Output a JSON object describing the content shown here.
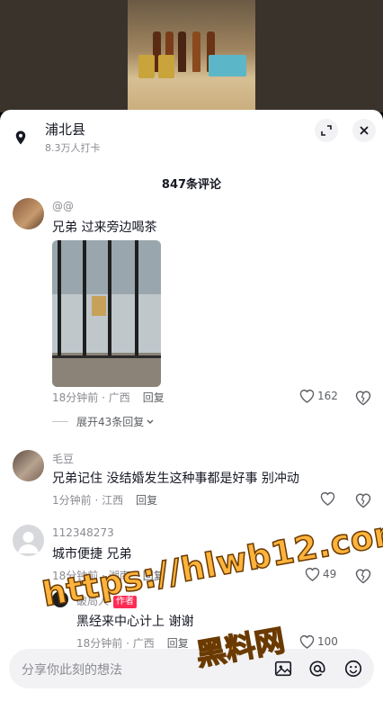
{
  "location": {
    "title": "浦北县",
    "subtitle": "8.3万人打卡"
  },
  "comment_count": "847条评论",
  "comments": [
    {
      "user": "@@",
      "text": "兄弟 过来旁边喝茶",
      "time": "18分钟前 · 广西",
      "reply": "回复",
      "likes": "162",
      "expand": "展开43条回复"
    },
    {
      "user": "毛豆",
      "text": "兄弟记住 没结婚发生这种事都是好事 别冲动",
      "time": "1分钟前 · 江西",
      "reply": "回复",
      "likes": ""
    },
    {
      "user": "112348273",
      "text": "城市便捷 兄弟",
      "time": "18分钟前 · 湖南",
      "reply": "回复",
      "likes": "49"
    }
  ],
  "sub_reply": {
    "user": "破局人",
    "badge": "作者",
    "text": "黑经来中心计上 谢谢",
    "time": "18分钟前 · 广西",
    "reply": "回复",
    "likes": "100"
  },
  "input": {
    "placeholder": "分享你此刻的想法"
  },
  "icons": [
    "location-pin-icon",
    "expand-icon",
    "close-icon",
    "heart-icon",
    "dislike-icon",
    "image-icon",
    "at-icon",
    "emoji-icon",
    "chevron-down-icon"
  ],
  "watermark": {
    "line1": "https://hlwb12.com",
    "line2": "黑料网"
  },
  "colors": {
    "accent": "#fe2c55",
    "watermark": "#ffb33c"
  }
}
